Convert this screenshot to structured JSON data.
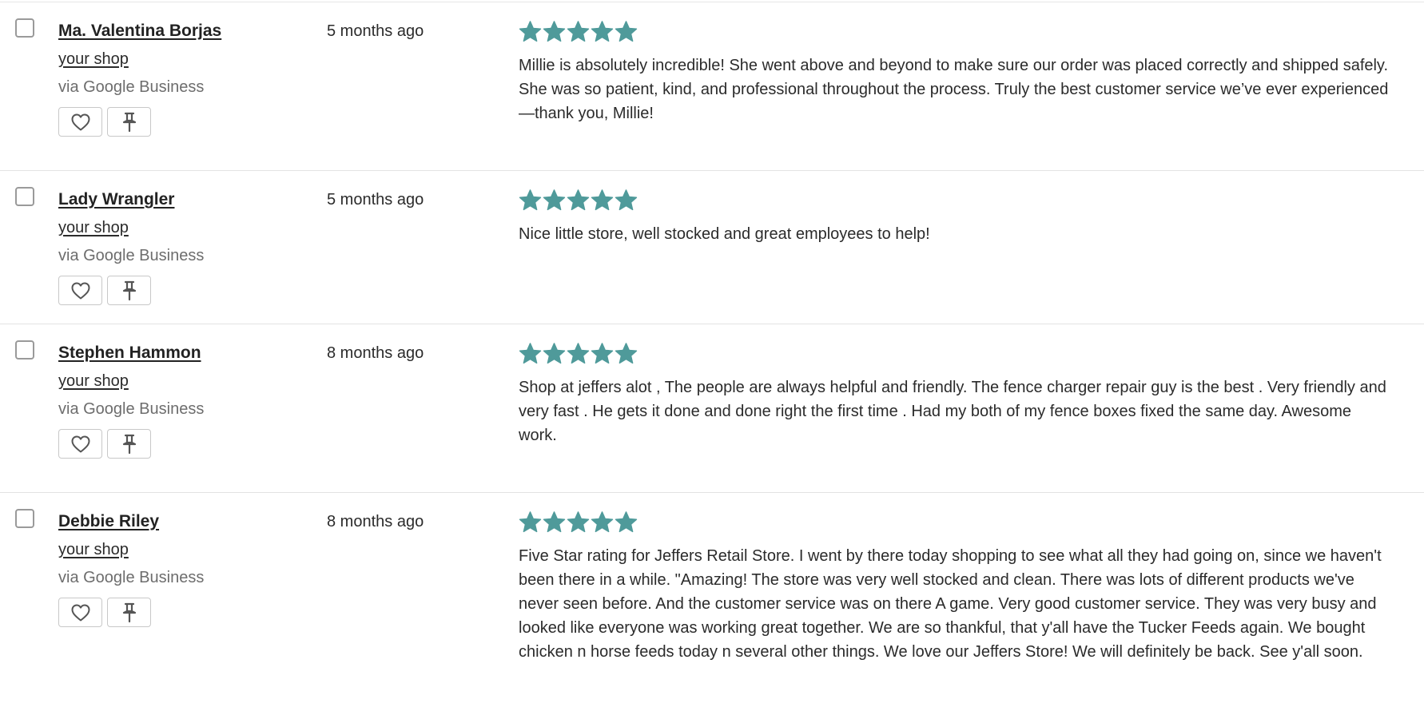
{
  "theme": {
    "star_color": "#4f9a9a"
  },
  "reviews": [
    {
      "author": "Ma. Valentina Borjas",
      "shop": "your shop",
      "source": "via Google Business",
      "date": "5 months ago",
      "rating": 5,
      "text": "Millie is absolutely incredible! She went above and beyond to make sure our order was placed correctly and shipped safely. She was so patient, kind, and professional throughout the process. Truly the best customer service we’ve ever experienced—thank you, Millie!"
    },
    {
      "author": "Lady Wrangler",
      "shop": "your shop",
      "source": "via Google Business",
      "date": "5 months ago",
      "rating": 5,
      "text": "Nice little store, well stocked and great employees to help!"
    },
    {
      "author": "Stephen Hammon",
      "shop": "your shop",
      "source": "via Google Business",
      "date": "8 months ago",
      "rating": 5,
      "text": "Shop at jeffers alot , The people are always helpful and friendly. The fence charger repair guy is the best . Very friendly and very fast . He gets it done and done right the first time . Had my both of my fence boxes fixed the same day. Awesome work."
    },
    {
      "author": "Debbie Riley",
      "shop": "your shop",
      "source": "via Google Business",
      "date": "8 months ago",
      "rating": 5,
      "text": "Five Star rating for Jeffers Retail Store. I went by there today shopping to see what all they had going on, since we haven't been there in a while. \"Amazing! The store was very well stocked and clean. There was lots of different products we've never seen before. And the customer service was on there A game. Very good customer service. They was very busy and looked like everyone was working great together. We are so thankful, that y'all have the Tucker Feeds again. We bought chicken n horse feeds today n several other things. We love our Jeffers Store! We will definitely be back. See y'all soon."
    }
  ]
}
